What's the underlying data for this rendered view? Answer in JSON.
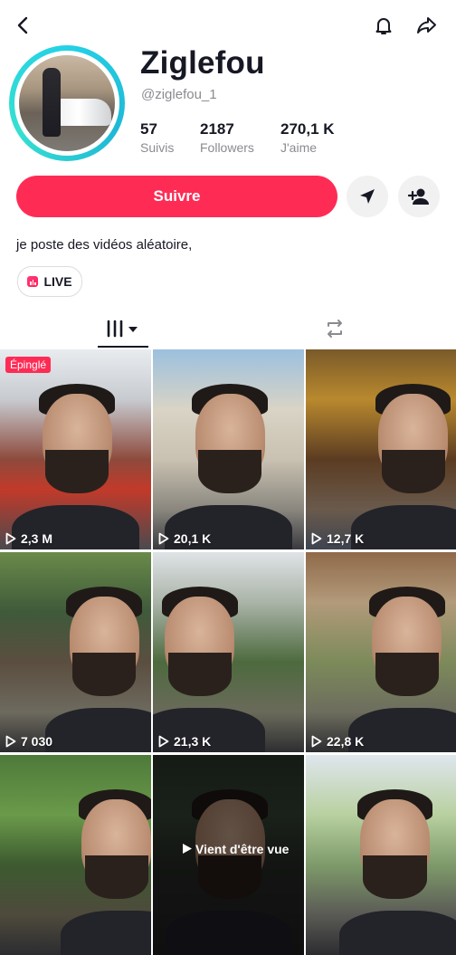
{
  "header": {
    "back_icon": "chevron-left-icon",
    "bell_icon": "bell-icon",
    "share_icon": "share-arrow-icon"
  },
  "profile": {
    "username": "Ziglefou",
    "handle": "@ziglefou_1",
    "stats": [
      {
        "value": "57",
        "label": "Suivis"
      },
      {
        "value": "2187",
        "label": "Followers"
      },
      {
        "value": "270,1 K",
        "label": "J'aime"
      }
    ],
    "follow_label": "Suivre",
    "bio": "je poste des vidéos aléatoire,",
    "live_label": "LIVE",
    "accent": "#fe2c55",
    "ring_color": "#25d1e6"
  },
  "tabs": {
    "videos_icon": "grid-icon",
    "reposts_icon": "repost-icon"
  },
  "videos": [
    {
      "views": "2,3 M",
      "pinned_label": "Épinglé",
      "bg": "linear-gradient(180deg,#e9ecef 0%,#c7cbd0 25%,#8d4a3c 55%,#c23a2a 70%,#4a4a4e 100%)"
    },
    {
      "views": "20,1 K",
      "bg": "linear-gradient(180deg,#9cc0de 0%,#d9d4c6 30%,#c9c1b1 55%,#8a877f 80%,#3a3a3e 100%)"
    },
    {
      "views": "12,7 K",
      "bg": "linear-gradient(180deg,#7a5a2a 0%,#b9892e 25%,#5b3c22 55%,#6a5a4c 80%,#3e4450 100%)"
    },
    {
      "views": "7 030",
      "bg": "linear-gradient(180deg,#6a8a4a 0%,#3f5a3a 30%,#5b4e40 55%,#6d6a5e 80%,#2a2a2e 100%)"
    },
    {
      "views": "21,3 K",
      "bg": "linear-gradient(180deg,#dfe3e6 0%,#aab4a8 25%,#4d6a3e 55%,#6a6a5a 80%,#2e2e32 100%)"
    },
    {
      "views": "22,8 K",
      "bg": "linear-gradient(180deg,#8f6a4a 0%,#b29a7a 25%,#7c8a5a 55%,#6d6d5e 80%,#2c2c30 100%)"
    },
    {
      "views": "",
      "bg": "linear-gradient(180deg,#4e7a3a 0%,#6a9a4a 30%,#3d5a30 55%,#4e4a3c 80%,#2c2c30 100%)"
    },
    {
      "views": "",
      "just_seen_label": "Vient d'être vue",
      "bg": "linear-gradient(180deg,#2f3a2f 0%,#3a4a3a 30%,#2a2e2a 55%,#222 100%)"
    },
    {
      "views": "",
      "bg": "linear-gradient(180deg,#dfe6ee 0%,#b8d0a0 30%,#7e9a6a 55%,#5a5a55 80%,#2c2c30 100%)"
    }
  ]
}
